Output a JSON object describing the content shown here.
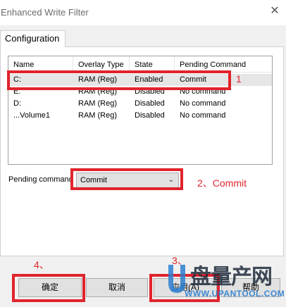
{
  "window": {
    "title": "Enhanced Write Filter"
  },
  "tabs": [
    {
      "label": "Configuration"
    }
  ],
  "table": {
    "headers": [
      "Name",
      "Overlay Type",
      "State",
      "Pending Command"
    ],
    "rows": [
      [
        "C:",
        "RAM (Reg)",
        "Enabled",
        "Commit"
      ],
      [
        "E:",
        "RAM (Reg)",
        "Disabled",
        "No command"
      ],
      [
        "D:",
        "RAM (Reg)",
        "Disabled",
        "No command"
      ],
      [
        "...Volume1",
        "RAM (Reg)",
        "Disabled",
        "No command"
      ]
    ],
    "selected_row": 0
  },
  "pending": {
    "label": "Pending command",
    "value": "Commit"
  },
  "buttons": {
    "ok": "确定",
    "cancel": "取消",
    "apply": "应用(A)",
    "help": "帮助"
  },
  "annotations": {
    "step1": "1",
    "step2": "2、Commit",
    "step3": "3、",
    "step4": "4、",
    "color": "#e0242c"
  },
  "watermark": {
    "brand": "盘量产网",
    "url": "WWW.UPANTOOL.COM"
  }
}
